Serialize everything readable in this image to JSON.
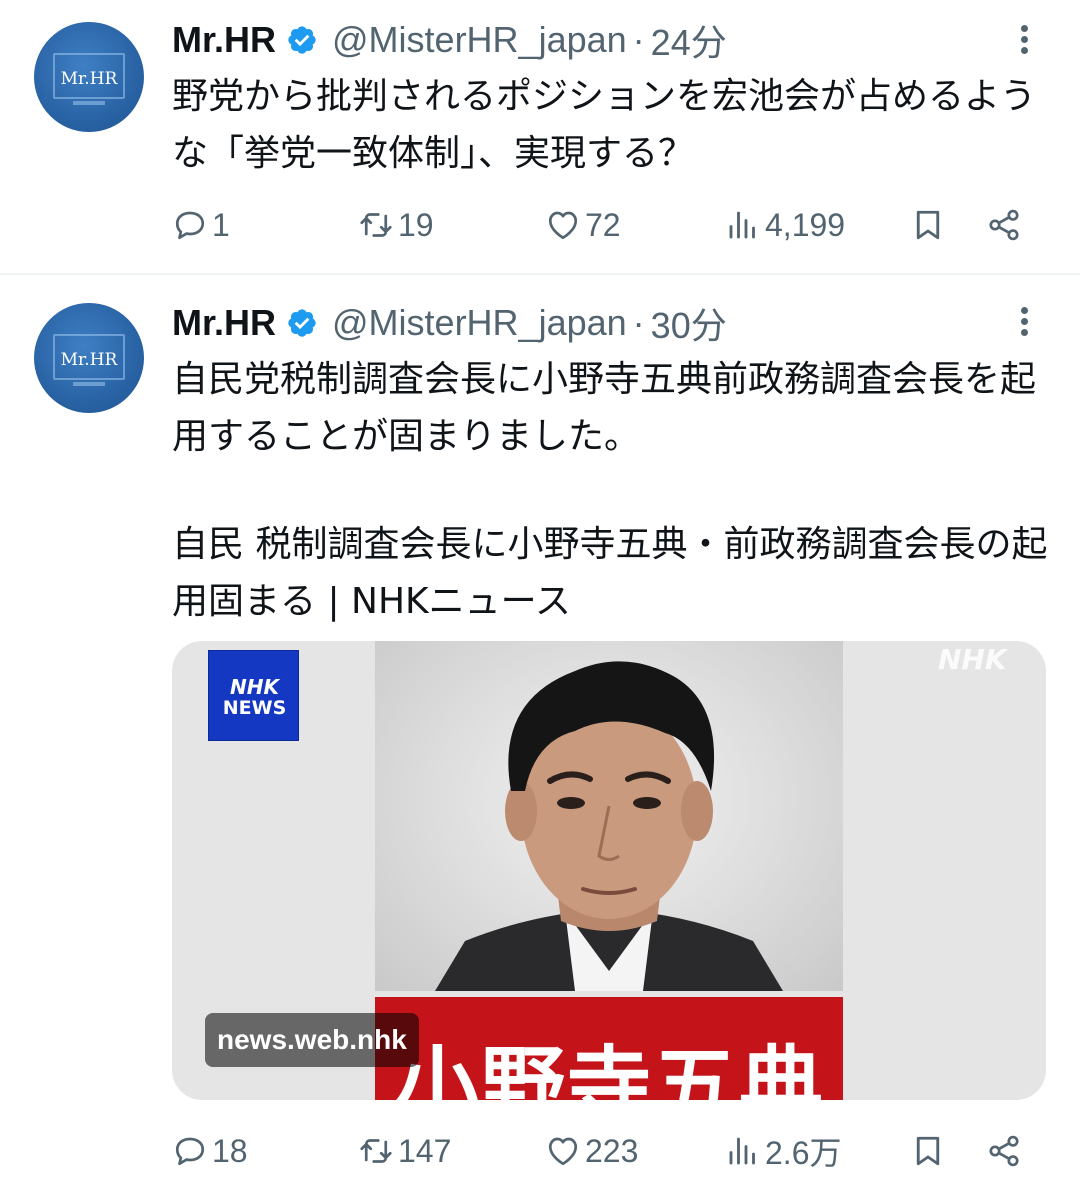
{
  "tweets": [
    {
      "author": {
        "name": "Mr.HR",
        "handle": "@MisterHR_japan",
        "avatar_label": "Mr.HR",
        "verified": true
      },
      "separator": "·",
      "time": "24分",
      "text": "野党から批判されるポジションを宏池会が占めるような「挙党一致体制」、実現する？",
      "stats": {
        "replies": "1",
        "retweets": "19",
        "likes": "72",
        "views": "4,199"
      }
    },
    {
      "author": {
        "name": "Mr.HR",
        "handle": "@MisterHR_japan",
        "avatar_label": "Mr.HR",
        "verified": true
      },
      "separator": "·",
      "time": "30分",
      "text": "自民党税制調査会長に小野寺五典前政務調査会長を起用することが固まりました。",
      "link_title": "自民 税制調査会長に小野寺五典・前政務調査会長の起用固まる | NHKニュース",
      "card": {
        "domain": "news.web.nhk",
        "logo_line1": "NHK",
        "logo_line2": "NEWS",
        "watermark": "NHK",
        "banner_text": "小野寺五典"
      },
      "stats": {
        "replies": "18",
        "retweets": "147",
        "likes": "223",
        "views": "2.6万"
      }
    }
  ],
  "colors": {
    "text_primary": "#0f1419",
    "text_secondary": "#536471",
    "verified_blue": "#1d9bf0",
    "avatar_blue": "#2b66a8",
    "banner_red": "#c4141a",
    "nhk_blue": "#1438c2"
  },
  "icons": [
    "verified-badge-icon",
    "more-icon",
    "reply-icon",
    "retweet-icon",
    "like-icon",
    "views-icon",
    "bookmark-icon",
    "share-icon"
  ]
}
